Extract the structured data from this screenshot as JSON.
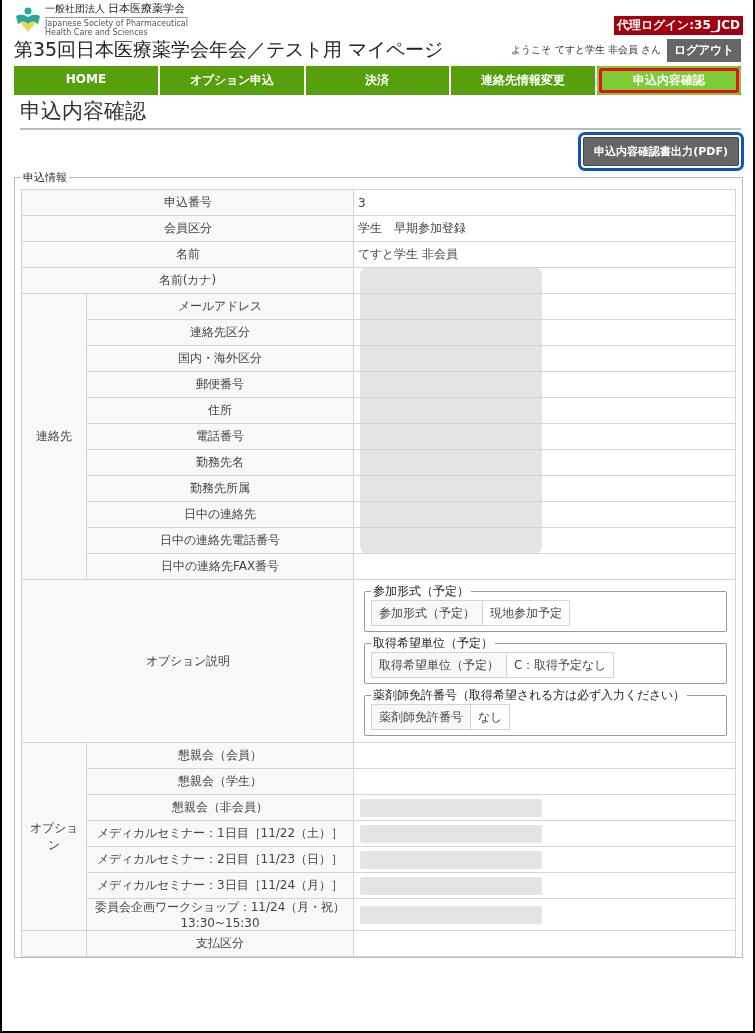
{
  "header": {
    "logo": {
      "org_small": "一般社団法人",
      "org": "日本医療薬学会",
      "english_1": "Japanese Society of Pharmaceutical",
      "english_2": "Health Care and Sciences"
    },
    "proxy_badge": "代理ログイン:35_JCD",
    "title": "第35回日本医療薬学会年会／テスト用 マイページ",
    "welcome": "ようこそ てすと学生 非会員 さん",
    "logout": "ログアウト"
  },
  "nav": [
    {
      "label": "HOME",
      "selected": false
    },
    {
      "label": "オプション申込",
      "selected": false
    },
    {
      "label": "決済",
      "selected": false
    },
    {
      "label": "連絡先情報変更",
      "selected": false
    },
    {
      "label": "申込内容確認",
      "selected": true
    }
  ],
  "page_heading": "申込内容確認",
  "pdf_button": "申込内容確認書出力(PDF)",
  "section": {
    "legend": "申込情報",
    "rows": [
      {
        "kind": "single",
        "label": "申込番号",
        "value": "3",
        "redacted": false
      },
      {
        "kind": "single",
        "label": "会員区分",
        "value": "学生　早期参加登録",
        "redacted": false
      },
      {
        "kind": "single",
        "label": "名前",
        "value": "てすと学生 非会員",
        "redacted": false
      },
      {
        "kind": "single",
        "label": "名前(カナ)",
        "value": "",
        "redacted": true
      },
      {
        "kind": "group",
        "label": "連絡先",
        "rows": [
          {
            "label": "メールアドレス",
            "redacted": true
          },
          {
            "label": "連絡先区分",
            "redacted": true
          },
          {
            "label": "国内・海外区分",
            "redacted": true
          },
          {
            "label": "郵便番号",
            "redacted": true
          },
          {
            "label": "住所",
            "redacted": true
          },
          {
            "label": "電話番号",
            "redacted": true
          },
          {
            "label": "勤務先名",
            "redacted": true
          },
          {
            "label": "勤務先所属",
            "redacted": true
          },
          {
            "label": "日中の連絡先",
            "redacted": true
          },
          {
            "label": "日中の連絡先電話番号",
            "redacted": true
          },
          {
            "label": "日中の連絡先FAX番号",
            "redacted": false
          }
        ]
      },
      {
        "kind": "options",
        "label": "オプション説明",
        "boxes": [
          {
            "legend": "参加形式（予定）",
            "label": "参加形式（予定）",
            "value": "現地参加予定"
          },
          {
            "legend": "取得希望単位（予定）",
            "label": "取得希望単位（予定）",
            "value": "C：取得予定なし"
          },
          {
            "legend": "薬剤師免許番号（取得希望される方は必ず入力ください）",
            "label": "薬剤師免許番号",
            "value": "なし"
          }
        ]
      },
      {
        "kind": "option_group",
        "label": "オプション",
        "rows": [
          {
            "label": "懇親会（会員）",
            "redacted": false
          },
          {
            "label": "懇親会（学生）",
            "redacted": false
          },
          {
            "label": "懇親会（非会員）",
            "redacted": true
          },
          {
            "label": "メディカルセミナー：1日目［11/22（土）］",
            "redacted": true
          },
          {
            "label": "メディカルセミナー：2日目［11/23（日）］",
            "redacted": true
          },
          {
            "label": "メディカルセミナー：3日目［11/24（月）］",
            "redacted": true
          },
          {
            "label": "委員会企画ワークショップ：11/24（月・祝）13:30~15:30",
            "redacted": true
          }
        ]
      },
      {
        "kind": "option_group",
        "label": "",
        "rows": [
          {
            "label": "支払区分",
            "redacted": false
          }
        ]
      }
    ]
  }
}
